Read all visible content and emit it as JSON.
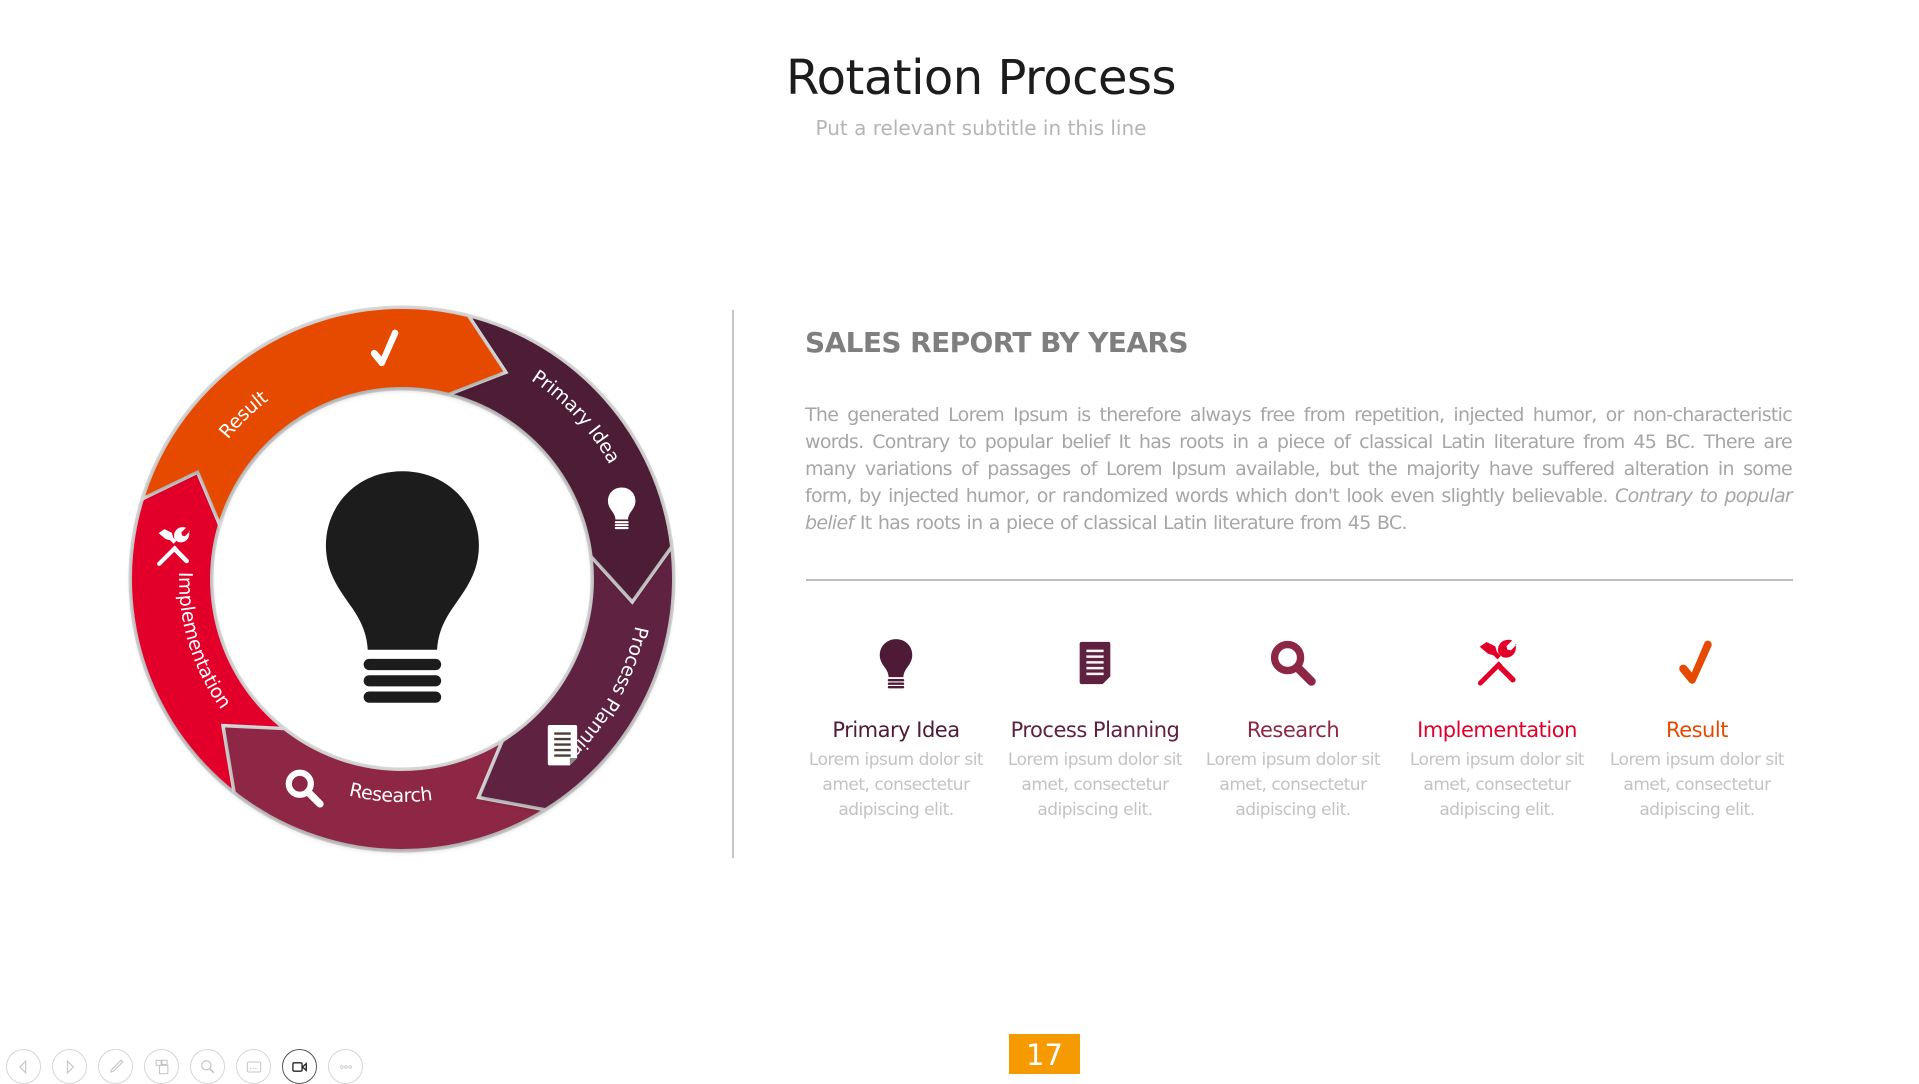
{
  "slide": {
    "title": "Rotation Process",
    "subtitle": "Put a relevant subtitle in this line",
    "page_number": "17"
  },
  "ring": {
    "center_icon": "lightbulb-icon",
    "segments": [
      {
        "label": "Primary Idea",
        "icon": "lightbulb-icon",
        "color": "#4E1A36"
      },
      {
        "label": "Process Planning",
        "icon": "document-icon",
        "color": "#5E2240"
      },
      {
        "label": "Research",
        "icon": "magnifier-icon",
        "color": "#8E2745"
      },
      {
        "label": "Implementation",
        "icon": "tools-icon",
        "color": "#E2002B"
      },
      {
        "label": "Result",
        "icon": "checkmark-icon",
        "color": "#E64A00"
      }
    ]
  },
  "report": {
    "heading": "SALES REPORT BY YEARS",
    "body_plain": "The generated Lorem Ipsum is therefore always free from repetition, injected humor, or non-characteristic words. Contrary to popular belief It has roots in a piece of classical Latin literature from 45 BC. There are many variations of passages of Lorem Ipsum available, but the majority have suffered alteration in some form, by injected humor, or randomized words which don't look even slightly believable.",
    "body_italic": "Contrary to popular belief",
    "body_tail": "It has roots in a piece of classical Latin literature from 45 BC."
  },
  "steps": [
    {
      "title": "Primary Idea",
      "icon": "lightbulb-icon",
      "color": "#4E1A36",
      "desc": "Lorem ipsum dolor sit amet, consectetur adipiscing elit."
    },
    {
      "title": "Process Planning",
      "icon": "document-icon",
      "color": "#5E2240",
      "desc": "Lorem ipsum dolor sit amet, consectetur adipiscing elit."
    },
    {
      "title": "Research",
      "icon": "magnifier-icon",
      "color": "#8E2745",
      "desc": "Lorem ipsum dolor sit amet, consectetur adipiscing elit."
    },
    {
      "title": "Implementation",
      "icon": "tools-icon",
      "color": "#E2002B",
      "desc": "Lorem ipsum dolor sit amet, consectetur adipiscing elit."
    },
    {
      "title": "Result",
      "icon": "checkmark-icon",
      "color": "#E64A00",
      "desc": "Lorem ipsum dolor sit amet, consectetur adipiscing elit."
    }
  ],
  "toolbar": {
    "buttons": [
      {
        "name": "previous-slide-button",
        "icon": "arrow-left-icon"
      },
      {
        "name": "next-slide-button",
        "icon": "arrow-right-icon"
      },
      {
        "name": "pen-button",
        "icon": "pen-icon"
      },
      {
        "name": "slides-overview-button",
        "icon": "grid-icon"
      },
      {
        "name": "zoom-button",
        "icon": "magnifier-icon"
      },
      {
        "name": "subtitles-button",
        "icon": "subtitles-icon"
      },
      {
        "name": "camera-button",
        "icon": "video-camera-icon",
        "active": true
      },
      {
        "name": "more-options-button",
        "icon": "more-icon"
      }
    ]
  }
}
